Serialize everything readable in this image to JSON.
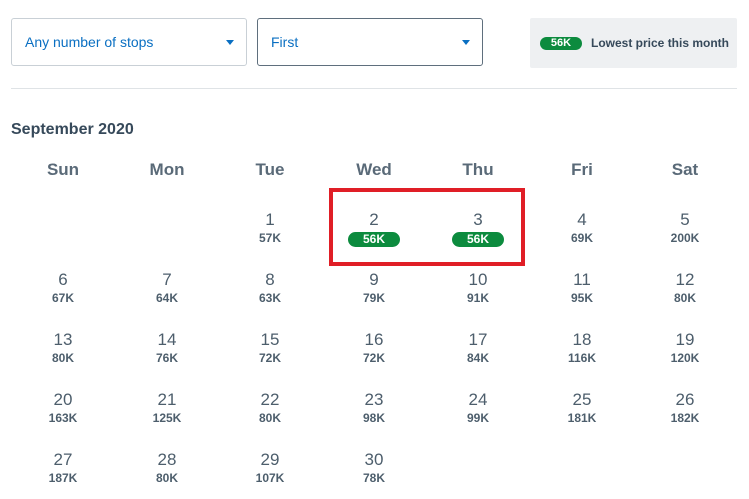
{
  "filters": {
    "stops": {
      "value": "Any number of stops"
    },
    "cabin": {
      "value": "First"
    }
  },
  "legend": {
    "badge": "56K",
    "label": "Lowest price this month"
  },
  "calendar": {
    "month": "September 2020",
    "weekdays": [
      "Sun",
      "Mon",
      "Tue",
      "Wed",
      "Thu",
      "Fri",
      "Sat"
    ],
    "first_weekday_index": 2,
    "days": [
      {
        "day": "1",
        "price": "57K",
        "lowest": false
      },
      {
        "day": "2",
        "price": "56K",
        "lowest": true
      },
      {
        "day": "3",
        "price": "56K",
        "lowest": true
      },
      {
        "day": "4",
        "price": "69K",
        "lowest": false
      },
      {
        "day": "5",
        "price": "200K",
        "lowest": false
      },
      {
        "day": "6",
        "price": "67K",
        "lowest": false
      },
      {
        "day": "7",
        "price": "64K",
        "lowest": false
      },
      {
        "day": "8",
        "price": "63K",
        "lowest": false
      },
      {
        "day": "9",
        "price": "79K",
        "lowest": false
      },
      {
        "day": "10",
        "price": "91K",
        "lowest": false
      },
      {
        "day": "11",
        "price": "95K",
        "lowest": false
      },
      {
        "day": "12",
        "price": "80K",
        "lowest": false
      },
      {
        "day": "13",
        "price": "80K",
        "lowest": false
      },
      {
        "day": "14",
        "price": "76K",
        "lowest": false
      },
      {
        "day": "15",
        "price": "72K",
        "lowest": false
      },
      {
        "day": "16",
        "price": "72K",
        "lowest": false
      },
      {
        "day": "17",
        "price": "84K",
        "lowest": false
      },
      {
        "day": "18",
        "price": "116K",
        "lowest": false
      },
      {
        "day": "19",
        "price": "120K",
        "lowest": false
      },
      {
        "day": "20",
        "price": "163K",
        "lowest": false
      },
      {
        "day": "21",
        "price": "125K",
        "lowest": false
      },
      {
        "day": "22",
        "price": "80K",
        "lowest": false
      },
      {
        "day": "23",
        "price": "98K",
        "lowest": false
      },
      {
        "day": "24",
        "price": "99K",
        "lowest": false
      },
      {
        "day": "25",
        "price": "181K",
        "lowest": false
      },
      {
        "day": "26",
        "price": "182K",
        "lowest": false
      },
      {
        "day": "27",
        "price": "187K",
        "lowest": false
      },
      {
        "day": "28",
        "price": "80K",
        "lowest": false
      },
      {
        "day": "29",
        "price": "107K",
        "lowest": false
      },
      {
        "day": "30",
        "price": "78K",
        "lowest": false
      }
    ]
  },
  "colors": {
    "accent": "#0a6fc2",
    "lowest_badge": "#0c8b3e",
    "highlight": "#e01e26"
  }
}
